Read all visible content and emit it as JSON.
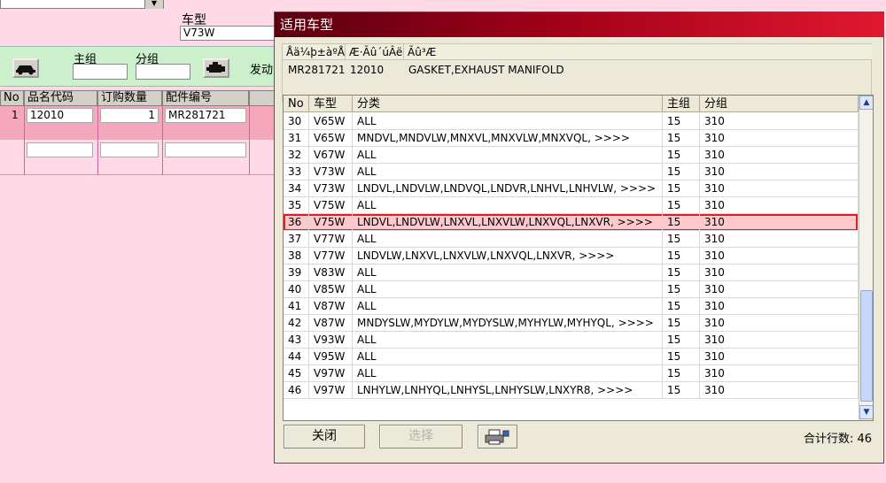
{
  "background_form": {
    "cartype_label": "车型",
    "cartype_value": "V73W",
    "main_group_label": "主组",
    "sub_group_label": "分组",
    "engine_label": "发动",
    "grid_headers": [
      "No",
      "品名代码",
      "订购数量",
      "配件编号"
    ],
    "grid_row": {
      "no": "1",
      "code": "12010",
      "qty": "1",
      "part": "MR281721"
    }
  },
  "dialog": {
    "title": "适用车型",
    "info_headers": [
      "Åä¼þ±àºÅ",
      "Æ·Ãû´úÂë",
      "Ãû³Æ"
    ],
    "info_values": {
      "part_no": "MR281721",
      "code": "12010",
      "name": "GASKET,EXHAUST MANIFOLD"
    },
    "columns": [
      "No",
      "车型",
      "分类",
      "主组",
      "分组"
    ],
    "rows": [
      [
        "30",
        "V65W",
        "ALL",
        "15",
        "310"
      ],
      [
        "31",
        "V65W",
        "MNDVL,MNDVLW,MNXVL,MNXVLW,MNXVQL, >>>>",
        "15",
        "310"
      ],
      [
        "32",
        "V67W",
        "ALL",
        "15",
        "310"
      ],
      [
        "33",
        "V73W",
        "ALL",
        "15",
        "310"
      ],
      [
        "34",
        "V73W",
        "LNDVL,LNDVLW,LNDVQL,LNDVR,LNHVL,LNHVLW, >>>>",
        "15",
        "310"
      ],
      [
        "35",
        "V75W",
        "ALL",
        "15",
        "310"
      ],
      [
        "36",
        "V75W",
        "LNDVL,LNDVLW,LNXVL,LNXVLW,LNXVQL,LNXVR, >>>>",
        "15",
        "310"
      ],
      [
        "37",
        "V77W",
        "ALL",
        "15",
        "310"
      ],
      [
        "38",
        "V77W",
        "LNDVLW,LNXVL,LNXVLW,LNXVQL,LNXVR, >>>>",
        "15",
        "310"
      ],
      [
        "39",
        "V83W",
        "ALL",
        "15",
        "310"
      ],
      [
        "40",
        "V85W",
        "ALL",
        "15",
        "310"
      ],
      [
        "41",
        "V87W",
        "ALL",
        "15",
        "310"
      ],
      [
        "42",
        "V87W",
        "MNDYSLW,MYDYLW,MYDYSLW,MYHYLW,MYHYQL, >>>>",
        "15",
        "310"
      ],
      [
        "43",
        "V93W",
        "ALL",
        "15",
        "310"
      ],
      [
        "44",
        "V95W",
        "ALL",
        "15",
        "310"
      ],
      [
        "45",
        "V97W",
        "ALL",
        "15",
        "310"
      ],
      [
        "46",
        "V97W",
        "LNHYLW,LNHYQL,LNHYSL,LNHYSLW,LNXYR8, >>>>",
        "15",
        "310"
      ]
    ],
    "selected_row_no": "36",
    "close_button": "关闭",
    "select_button": "选择",
    "total_label": "合计行数: 46",
    "icons": {
      "print": "printer-icon",
      "car": "car-icon",
      "engine": "engine-icon"
    }
  }
}
